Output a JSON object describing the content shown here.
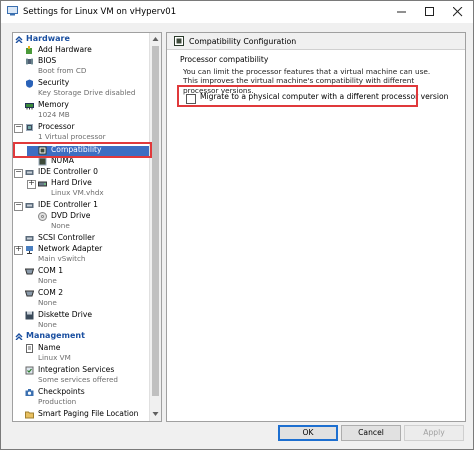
{
  "window": {
    "title": "Settings for Linux VM on vHyperv01"
  },
  "hardware_section": {
    "label": "Hardware"
  },
  "management_section": {
    "label": "Management"
  },
  "tree": {
    "add_hardware": {
      "label": "Add Hardware"
    },
    "bios": {
      "label": "BIOS",
      "detail": "Boot from CD"
    },
    "security": {
      "label": "Security",
      "detail": "Key Storage Drive disabled"
    },
    "memory": {
      "label": "Memory",
      "detail": "1024 MB"
    },
    "processor": {
      "label": "Processor",
      "detail": "1 Virtual processor"
    },
    "compatibility": {
      "label": "Compatibility"
    },
    "numa": {
      "label": "NUMA"
    },
    "ide0": {
      "label": "IDE Controller 0"
    },
    "hard_drive": {
      "label": "Hard Drive",
      "detail": "Linux VM.vhdx"
    },
    "ide1": {
      "label": "IDE Controller 1"
    },
    "dvd": {
      "label": "DVD Drive",
      "detail": "None"
    },
    "scsi": {
      "label": "SCSI Controller"
    },
    "nic": {
      "label": "Network Adapter",
      "detail": "Main vSwitch"
    },
    "com1": {
      "label": "COM 1",
      "detail": "None"
    },
    "com2": {
      "label": "COM 2",
      "detail": "None"
    },
    "diskette": {
      "label": "Diskette Drive",
      "detail": "None"
    },
    "name": {
      "label": "Name",
      "detail": "Linux VM"
    },
    "integration": {
      "label": "Integration Services",
      "detail": "Some services offered"
    },
    "checkpoints": {
      "label": "Checkpoints",
      "detail": "Production"
    },
    "smart_paging": {
      "label": "Smart Paging File Location"
    }
  },
  "config": {
    "header": "Compatibility Configuration",
    "group_title": "Processor compatibility",
    "description": "You can limit the processor features that a virtual machine can use. This improves the virtual machine's compatibility with different processor versions.",
    "migrate_checkbox": {
      "label": "Migrate to a physical computer with a different processor version",
      "checked": false
    }
  },
  "buttons": {
    "ok": "OK",
    "cancel": "Cancel",
    "apply": "Apply"
  },
  "colors": {
    "selection": "#3d6ec2",
    "highlight_box": "#e0393b",
    "section_header": "#1a4fa0"
  }
}
